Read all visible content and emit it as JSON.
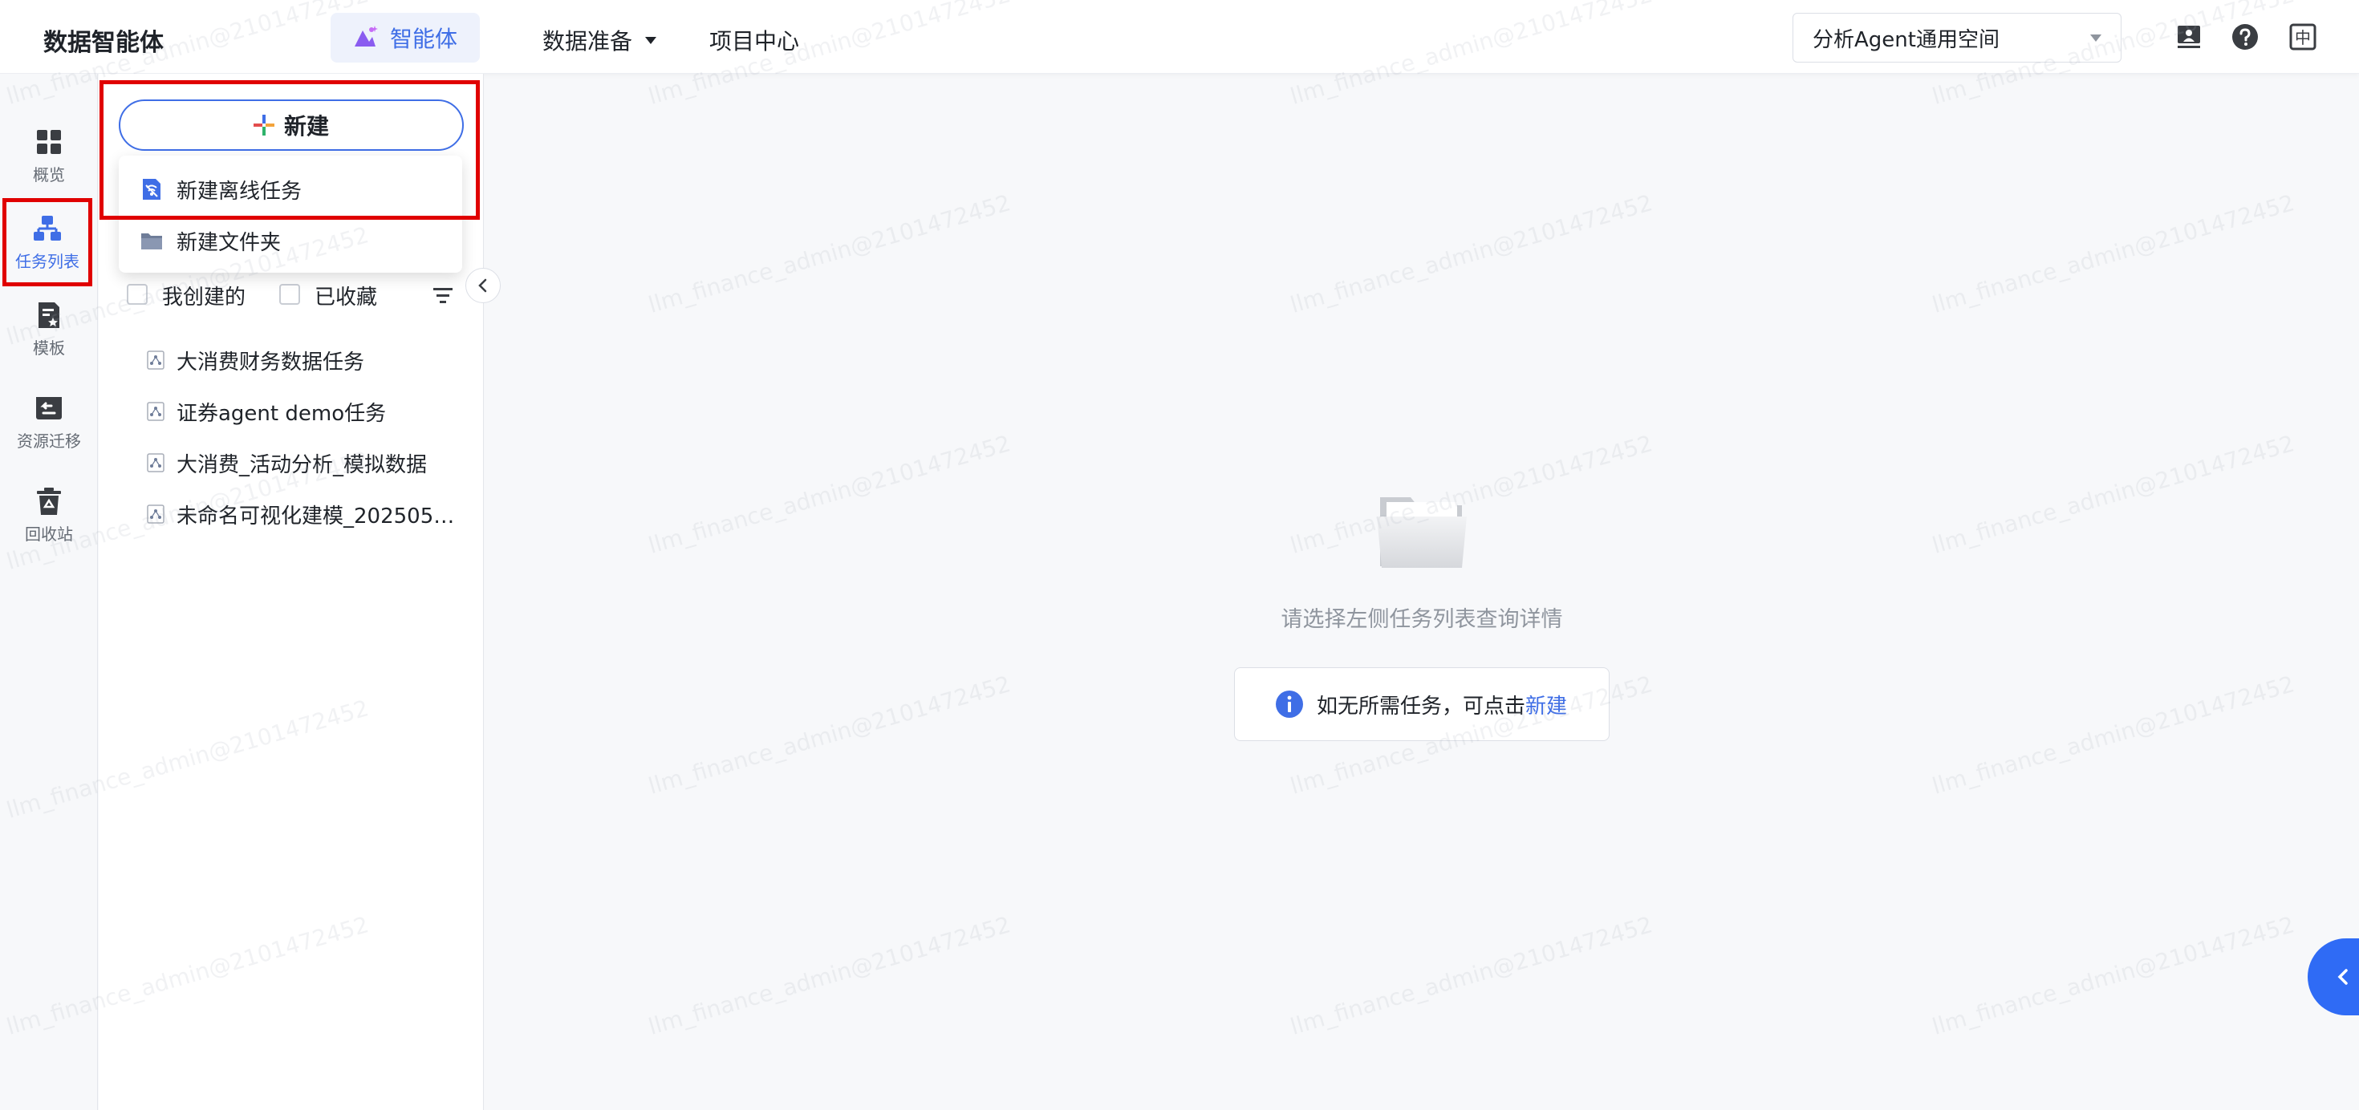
{
  "header": {
    "brand": "数据智能体",
    "agent_tab": "智能体",
    "nav": [
      {
        "label": "数据准备"
      },
      {
        "label": "项目中心"
      }
    ],
    "space_select": {
      "value": "分析Agent通用空间"
    },
    "icons": [
      "screen-share-icon",
      "help-icon",
      "language-zh-icon"
    ],
    "language_glyph": "中"
  },
  "rail": {
    "items": [
      {
        "label": "概览",
        "icon": "grid-icon"
      },
      {
        "label": "任务列表",
        "icon": "task-tree-icon",
        "active": true
      },
      {
        "label": "模板",
        "icon": "template-icon"
      },
      {
        "label": "资源迁移",
        "icon": "migrate-icon"
      },
      {
        "label": "回收站",
        "icon": "recycle-icon"
      }
    ]
  },
  "panel": {
    "new_button": "新建",
    "dropdown": [
      {
        "label": "新建离线任务",
        "icon": "offline-task-icon"
      },
      {
        "label": "新建文件夹",
        "icon": "folder-icon"
      }
    ],
    "filters": [
      {
        "label": "我创建的",
        "checked": false
      },
      {
        "label": "已收藏",
        "checked": false
      }
    ],
    "tasks": [
      {
        "label": "大消费财务数据任务"
      },
      {
        "label": "证券agent demo任务"
      },
      {
        "label": "大消费_活动分析_模拟数据"
      },
      {
        "label": "未命名可视化建模_2025051..."
      }
    ]
  },
  "main": {
    "empty_text": "请选择左侧任务列表查询详情",
    "hint_text": "如无所需任务，可点击",
    "hint_link": "新建"
  },
  "watermark": "llm_finance_admin@2101472452",
  "colors": {
    "accent": "#3f6ee6",
    "highlight_box": "#e00000",
    "float_button": "#2f6bf5"
  }
}
